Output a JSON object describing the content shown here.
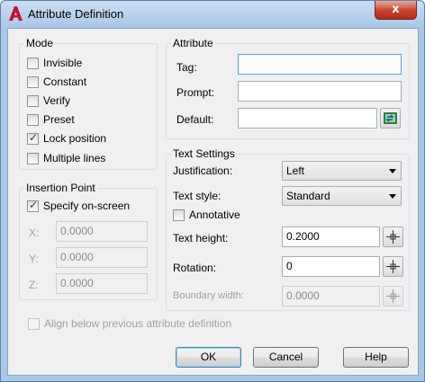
{
  "window": {
    "title": "Attribute Definition",
    "close_glyph": "x"
  },
  "mode": {
    "label": "Mode",
    "items": [
      {
        "label": "Invisible",
        "checked": false
      },
      {
        "label": "Constant",
        "checked": false
      },
      {
        "label": "Verify",
        "checked": false
      },
      {
        "label": "Preset",
        "checked": false
      },
      {
        "label": "Lock position",
        "checked": true
      },
      {
        "label": "Multiple lines",
        "checked": false
      }
    ]
  },
  "insertion_point": {
    "label": "Insertion Point",
    "specify_label": "Specify on-screen",
    "specify_checked": true,
    "x_label": "X:",
    "x_value": "0.0000",
    "y_label": "Y:",
    "y_value": "0.0000",
    "z_label": "Z:",
    "z_value": "0.0000"
  },
  "attribute": {
    "label": "Attribute",
    "tag_label": "Tag:",
    "tag_value": "",
    "prompt_label": "Prompt:",
    "prompt_value": "",
    "default_label": "Default:",
    "default_value": ""
  },
  "text_settings": {
    "label": "Text Settings",
    "justification_label": "Justification:",
    "justification_value": "Left",
    "text_style_label": "Text style:",
    "text_style_value": "Standard",
    "annotative_label": "Annotative",
    "annotative_checked": false,
    "text_height_label": "Text height:",
    "text_height_value": "0.2000",
    "rotation_label": "Rotation:",
    "rotation_value": "0",
    "boundary_width_label": "Boundary width:",
    "boundary_width_value": "0.0000"
  },
  "align_below": {
    "label": "Align below previous attribute definition",
    "checked": false
  },
  "buttons": {
    "ok": "OK",
    "cancel": "Cancel",
    "help": "Help"
  },
  "colors": {
    "title_bar": "#a9c7e8",
    "close_button": "#c7432b",
    "app_icon": "#c8102e",
    "dialog_bg": "#f0f0f0"
  }
}
